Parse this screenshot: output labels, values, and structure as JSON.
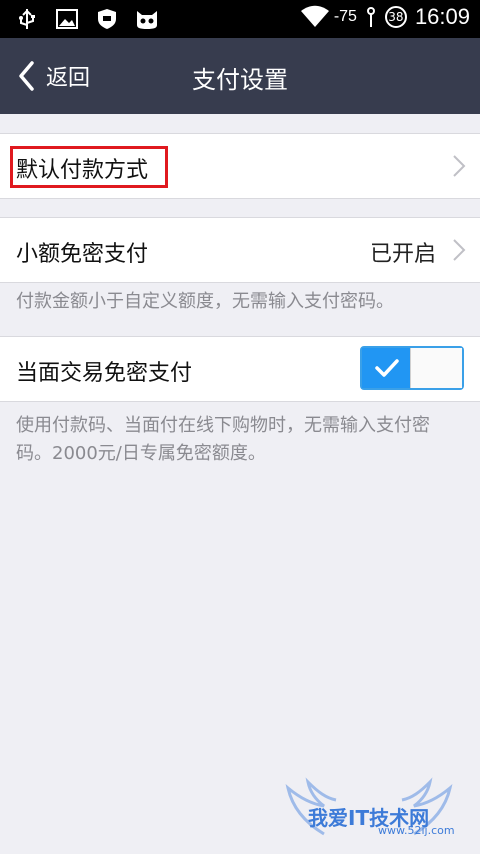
{
  "status_bar": {
    "icons": [
      "usb-icon",
      "image-icon",
      "shield-icon",
      "cat-icon",
      "wifi-icon"
    ],
    "signal_text": "-75",
    "battery": "38",
    "time": "16:09"
  },
  "nav": {
    "back_label": "返回",
    "title": "支付设置"
  },
  "settings": {
    "default_payment": {
      "label": "默认付款方式"
    },
    "small_amount": {
      "label": "小额免密支付",
      "value": "已开启"
    },
    "small_amount_note": "付款金额小于自定义额度，无需输入支付密码。",
    "face_to_face": {
      "label": "当面交易免密支付",
      "toggle_on": true
    },
    "face_to_face_note": "使用付款码、当面付在线下购物时，无需输入支付密码。2000元/日专属免密额度。"
  },
  "watermark": {
    "text": "我爱IT技术网",
    "url": "www.52ij.com"
  },
  "colors": {
    "navbar": "#373c4e",
    "toggle_on": "#2196f3",
    "highlight": "#e0191f",
    "background": "#efeff4"
  }
}
